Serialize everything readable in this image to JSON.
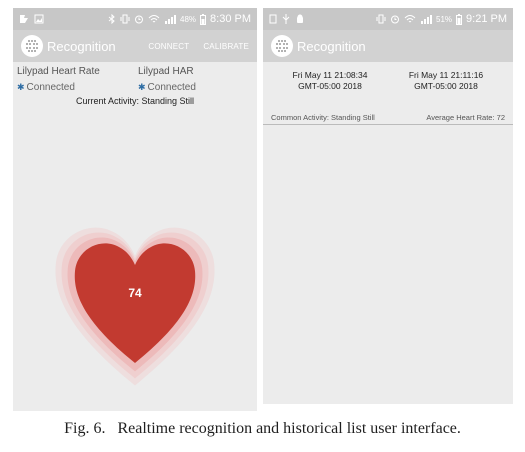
{
  "left_screen": {
    "status": {
      "battery": "48%",
      "time": "8:30 PM"
    },
    "app_title": "Recognition",
    "actions": {
      "connect": "CONNECT",
      "calibrate": "CALIBRATE"
    },
    "devices": [
      {
        "name": "Lilypad Heart Rate",
        "status": "Connected"
      },
      {
        "name": "Lilypad HAR",
        "status": "Connected"
      }
    ],
    "activity": "Current Activity: Standing Still",
    "heart_rate": "74",
    "colors": {
      "heart": "#c23a30",
      "glow": "#f2b4b4"
    }
  },
  "right_screen": {
    "status": {
      "battery": "51%",
      "time": "9:21 PM"
    },
    "app_title": "Recognition",
    "entries": [
      {
        "date": "Fri May 11 21:08:34",
        "tz": "GMT-05:00 2018"
      },
      {
        "date": "Fri May 11 21:11:16",
        "tz": "GMT-05:00 2018"
      }
    ],
    "common_activity": "Common Activity: Standing Still",
    "avg_heart_rate": "Average Heart Rate: 72"
  },
  "caption": "Fig. 6.   Realtime recognition and historical list user interface."
}
